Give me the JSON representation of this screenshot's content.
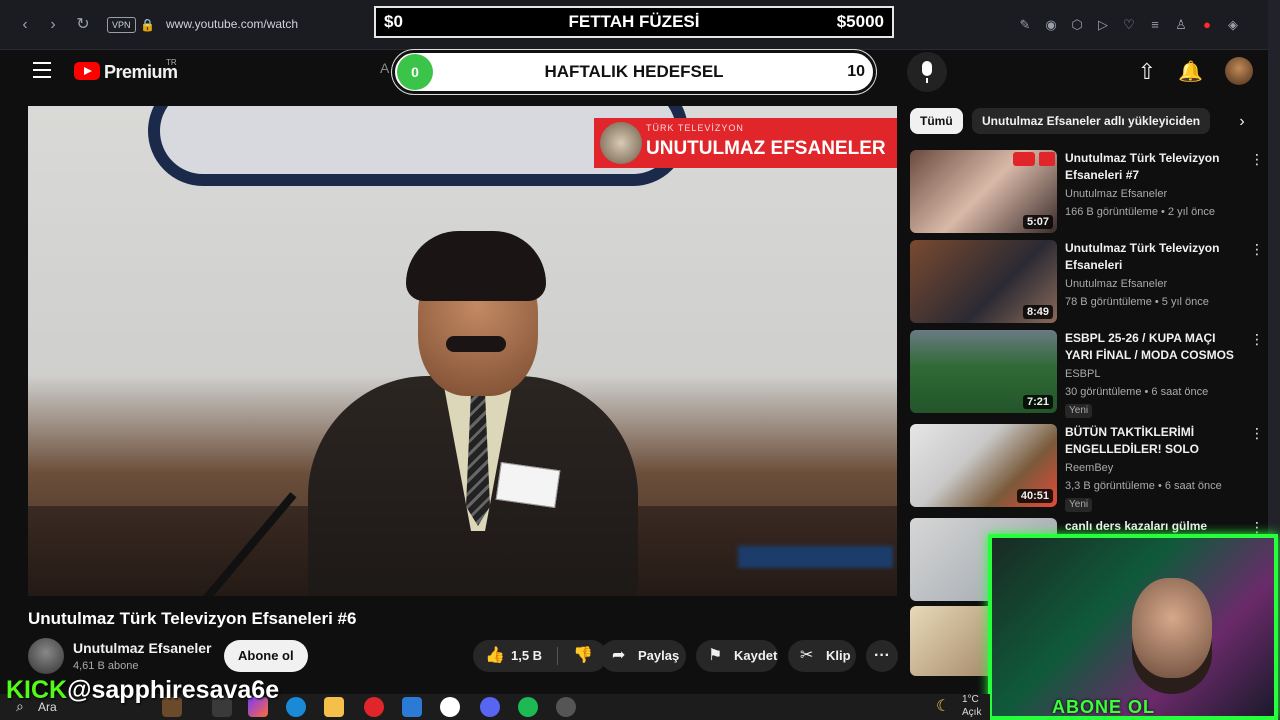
{
  "browser": {
    "url": "www.youtube.com/watch",
    "vpn_label": "VPN"
  },
  "stream_goal": {
    "left_amount": "$0",
    "title": "FETTAH FÜZESİ",
    "right_amount": "$5000"
  },
  "weekly_goal": {
    "current": "0",
    "title": "HAFTALIK HEDEFSEL",
    "target": "10"
  },
  "youtube": {
    "brand": "Premium",
    "region": "TR",
    "search_hint": "A"
  },
  "player": {
    "overlay_small": "TÜRK TELEVİZYON",
    "overlay_big": "UNUTULMAZ EFSANELER"
  },
  "video": {
    "title": "Unutulmaz Türk Televizyon Efsaneleri #6",
    "channel": "Unutulmaz Efsaneler",
    "subscribers": "4,61 B abone",
    "subscribe_label": "Abone ol",
    "likes": "1,5 B",
    "share_label": "Paylaş",
    "save_label": "Kaydet",
    "clip_label": "Klip"
  },
  "chips": [
    {
      "label": "Tümü",
      "active": true
    },
    {
      "label": "Unutulmaz Efsaneler adlı yükleyiciden",
      "active": false
    }
  ],
  "recommendations": [
    {
      "title": "Unutulmaz Türk Televizyon Efsaneleri #7",
      "channel": "Unutulmaz Efsaneler",
      "meta": "166 B görüntüleme • 2 yıl önce",
      "duration": "5:07",
      "new": ""
    },
    {
      "title": "Unutulmaz Türk Televizyon Efsaneleri",
      "channel": "Unutulmaz Efsaneler",
      "meta": "78 B görüntüleme • 5 yıl önce",
      "duration": "8:49",
      "new": ""
    },
    {
      "title": "ESBPL 25-26 / KUPA MAÇI YARI FİNAL / MODA COSMOS & ...",
      "channel": "ESBPL",
      "meta": "30 görüntüleme • 6 saat önce",
      "duration": "7:21",
      "new": "Yeni"
    },
    {
      "title": "BÜTÜN TAKTİKLERİMİ ENGELLEDİLER! SOLO RANKE...",
      "channel": "ReemBey",
      "meta": "3,3 B görüntüleme • 6 saat önce",
      "duration": "40:51",
      "new": "Yeni"
    },
    {
      "title": "canlı ders kazaları gülme",
      "channel": "",
      "meta": "",
      "duration": "",
      "new": ""
    }
  ],
  "webcam": {
    "text": "ABONE OL"
  },
  "kick": {
    "brand": "KICK",
    "handle": "@sapphiresava6e"
  },
  "taskbar": {
    "search": "Ara",
    "temp": "1°C",
    "weather": "Açık"
  },
  "colors": {
    "youtube_red": "#ff0000",
    "kick_green": "#53fc18",
    "cam_border": "#28ff3c"
  }
}
